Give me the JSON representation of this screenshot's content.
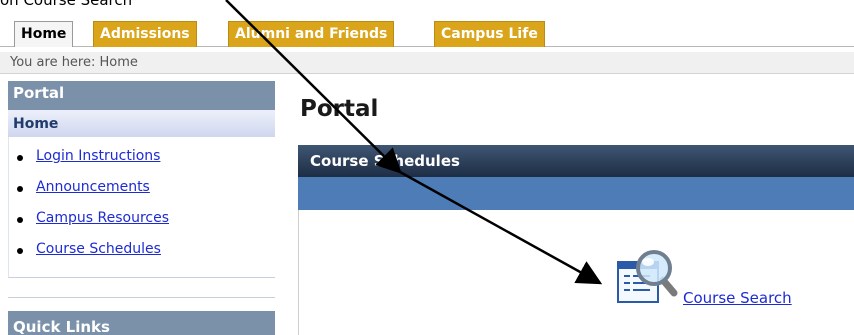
{
  "top_caption": "on Course Search",
  "tabs": [
    {
      "label": "Home",
      "active": true
    },
    {
      "label": "Admissions",
      "active": false
    },
    {
      "label": "Alumni and Friends",
      "active": false
    },
    {
      "label": "Campus Life",
      "active": false
    }
  ],
  "breadcrumb": "You are here:  Home",
  "sidebar": {
    "title": "Portal",
    "subtitle": "Home",
    "links": [
      "Login Instructions",
      "Announcements",
      "Campus Resources",
      "Course Schedules"
    ],
    "quick_links_title": "Quick Links"
  },
  "main": {
    "title": "Portal",
    "panel_title": "Course Schedules",
    "course_search_label": " Course Search",
    "icon": "magnifier-document-icon"
  },
  "colors": {
    "tab_inactive": "#dba51b",
    "sidebar_header": "#7a91a9",
    "panel_header": "#1d2d45",
    "panel_band": "#4e7cb6",
    "link": "#1d2bd3"
  }
}
